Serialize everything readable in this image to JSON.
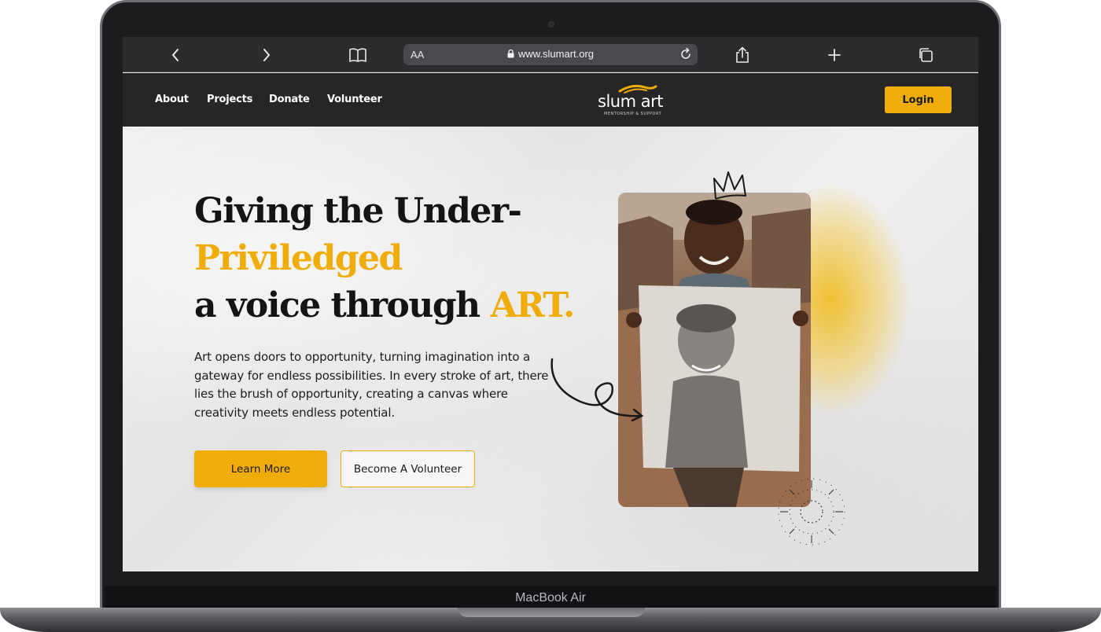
{
  "device": {
    "label": "MacBook Air"
  },
  "browser": {
    "text_size_label": "AA",
    "url": "www.slumart.org"
  },
  "nav": {
    "links": [
      "About",
      "Projects",
      "Donate",
      "Volunteer"
    ],
    "logo_text": "slum art",
    "logo_tagline": "MENTORSHIP & SUPPORT",
    "login_label": "Login"
  },
  "hero": {
    "headline_line1": "Giving the Under-",
    "headline_line2": "Priviledged",
    "headline_line3_start": "a voice through ",
    "headline_line3_accent": "ART.",
    "description": "Art opens doors to opportunity, turning imagination into a gateway for endless possibilities. In every stroke of art, there lies the brush of opportunity, creating a canvas where creativity meets endless potential.",
    "primary_cta": "Learn More",
    "secondary_cta": "Become A Volunteer"
  },
  "colors": {
    "accent": "#f0ad0a",
    "nav_bg": "#262626",
    "text": "#141414"
  }
}
